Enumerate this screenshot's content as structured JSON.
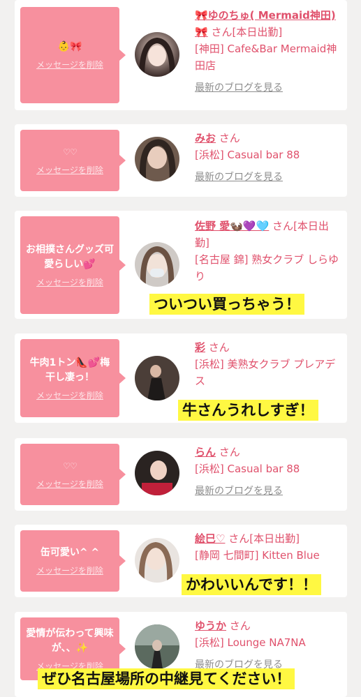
{
  "cards": [
    {
      "message": "👶🎀",
      "delete_label": "メッセージを削除",
      "name": "🎀ゆのちゅ( Mermaid神田)🎀",
      "san": "さん",
      "status": "[本日出勤]",
      "store": "[神田] Cafe&Bar Mermaid神田店",
      "blog": "最新のブログを見る"
    },
    {
      "message": "♡♡",
      "delete_label": "メッセージを削除",
      "name": "みお",
      "san": "さん",
      "status": "",
      "store": "[浜松] Casual bar 88",
      "blog": "最新のブログを見る"
    },
    {
      "message": "お相撲さんグッズ可愛らしい💕",
      "delete_label": "メッセージを削除",
      "name": "佐野 愛🦦💜🩵",
      "san": "さん",
      "status": "[本日出勤]",
      "store": "[名古屋 錦] 熟女クラブ しらゆり",
      "blog": ""
    },
    {
      "message": "牛肉1トン👠💕梅干し凄っ！",
      "delete_label": "メッセージを削除",
      "name": "彩",
      "san": "さん",
      "status": "",
      "store": "[浜松] 美熟女クラブ プレアデス",
      "blog": ""
    },
    {
      "message": "♡♡",
      "delete_label": "メッセージを削除",
      "name": "らん",
      "san": "さん",
      "status": "",
      "store": "[浜松] Casual bar 88",
      "blog": "最新のブログを見る"
    },
    {
      "message": "缶可愛い^ ^",
      "delete_label": "メッセージを削除",
      "name": "絵巳♡",
      "san": "さん",
      "status": "[本日出勤]",
      "store": "[静岡 七間町] Kitten Blue",
      "blog": ""
    },
    {
      "message": "愛情が伝わって興味が、、✨",
      "delete_label": "メッセージを削除",
      "name": "ゆうか",
      "san": "さん",
      "status": "",
      "store": "[浜松] Lounge NA7NA",
      "blog": "最新のブログを見る"
    }
  ],
  "captions": {
    "c1": "ついつい買っちゃう！",
    "c2": "牛さんうれしすぎ！",
    "c3": "かわいいんです！！",
    "c4": "ぜひ名古屋場所の中継見てください！"
  },
  "colors": {
    "accent": "#e0516c",
    "bubble": "#f7909e",
    "caption_bg": "#fff842"
  }
}
